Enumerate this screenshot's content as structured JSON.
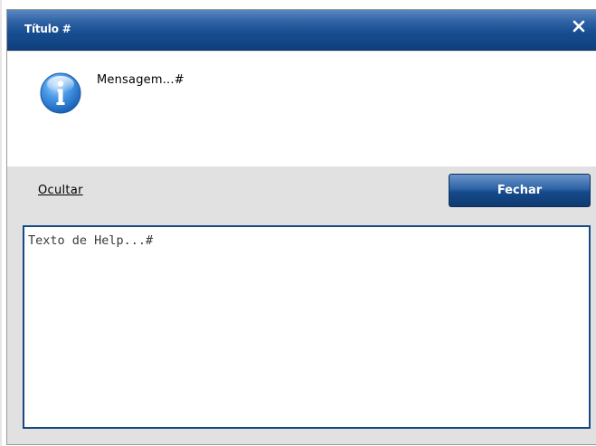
{
  "dialog": {
    "title": "Título #",
    "message": "Mensagem...#",
    "hide_link_label": "Ocultar",
    "close_button_label": "Fechar",
    "help_text": "Texto de Help...#",
    "icons": {
      "close": "close-icon",
      "info": "info-icon"
    },
    "colors": {
      "titlebar": "#174f92",
      "button": "#2e63a6",
      "help_border": "#174a84",
      "panel_background": "#e1e1e1"
    }
  }
}
